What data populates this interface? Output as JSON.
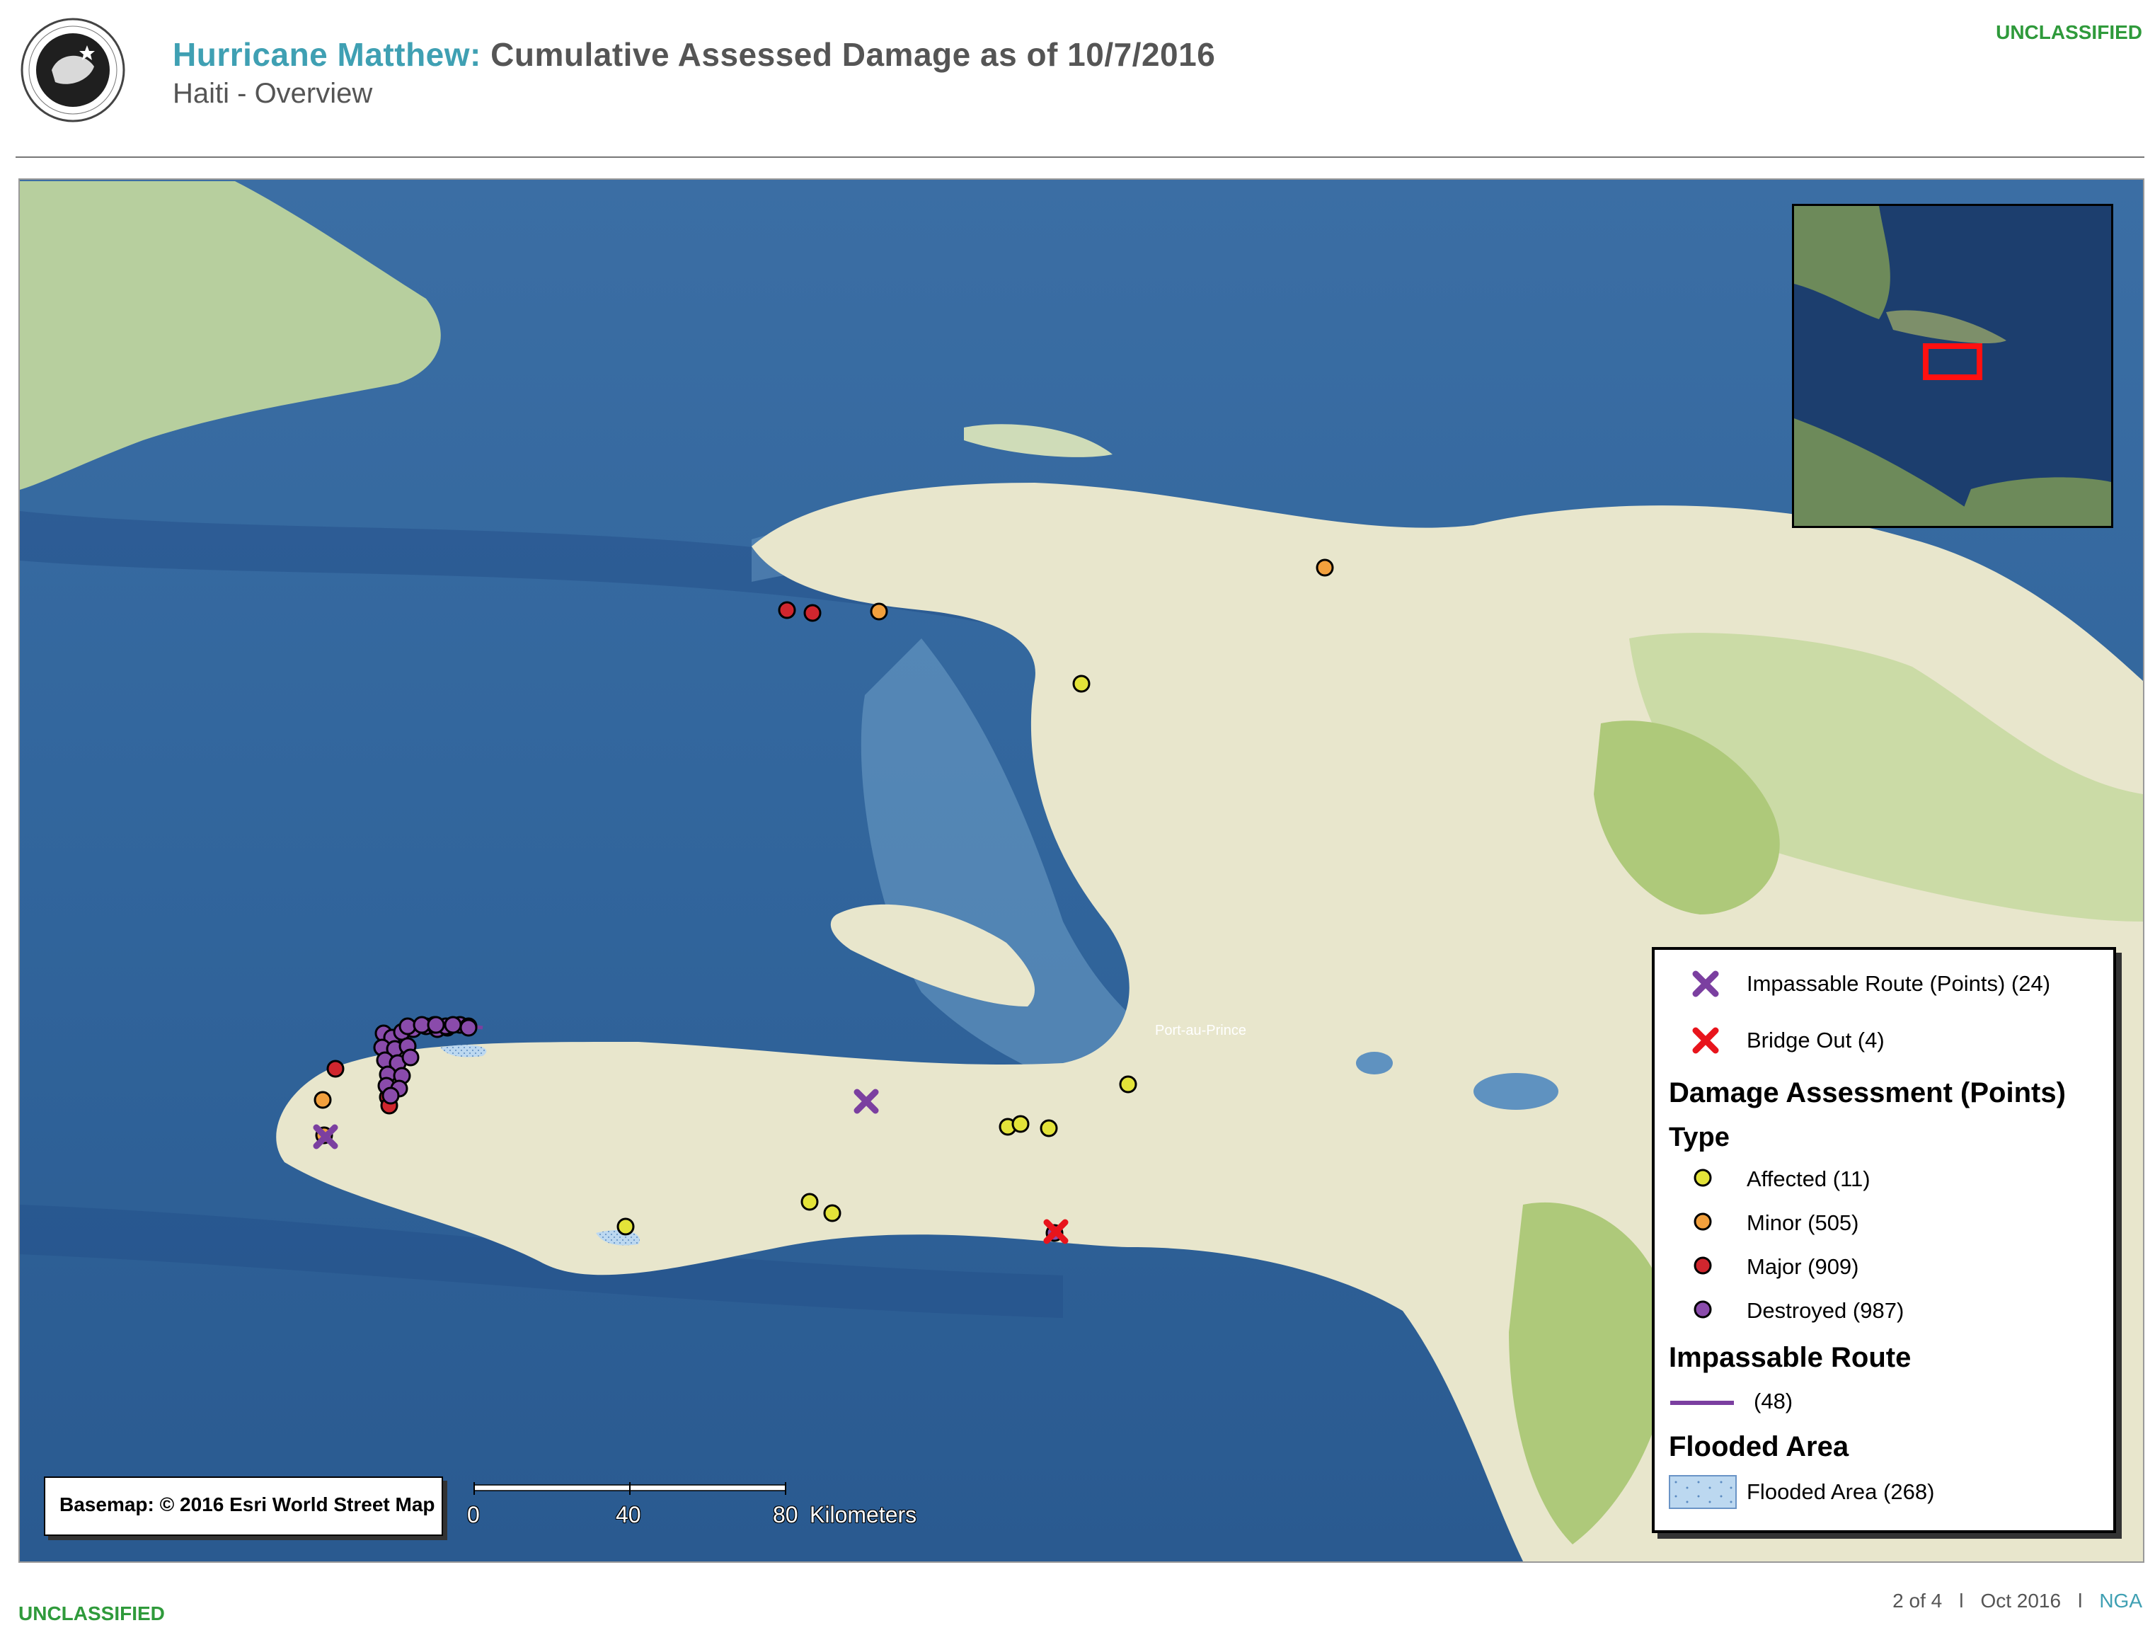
{
  "header": {
    "title_prefix": "Hurricane Matthew:",
    "title_rest": " Cumulative Assessed Damage as of 10/7/2016",
    "subtitle": "Haiti - Overview",
    "classification": "UNCLASSIFIED",
    "seal_text": "NATIONAL GEOSPATIAL-INTELLIGENCE AGENCY · UNITED STATES OF AMERICA"
  },
  "map": {
    "attribution": "Basemap: © 2016 Esri World Street Map",
    "city_label": "Port-au-Prince",
    "scalebar": {
      "ticks": [
        "0",
        "40",
        "80"
      ],
      "unit": "Kilometers"
    }
  },
  "legend": {
    "point_items": [
      {
        "label": "Impassable Route (Points) (24)",
        "symbol": "x-purple",
        "color": "#7b3fa0"
      },
      {
        "label": "Bridge Out (4)",
        "symbol": "x-red",
        "color": "#e8141c"
      }
    ],
    "damage_heading": "Damage Assessment (Points)",
    "type_heading": "Type",
    "damage_types": [
      {
        "label": "Affected (11)",
        "color": "#e3e339"
      },
      {
        "label": "Minor (505)",
        "color": "#f2a03d"
      },
      {
        "label": "Major (909)",
        "color": "#d0262e"
      },
      {
        "label": "Destroyed (987)",
        "color": "#8a4bab"
      }
    ],
    "route_heading": "Impassable Route",
    "route_item": {
      "label": "(48)",
      "color": "#7b3fa0"
    },
    "flood_heading": "Flooded Area",
    "flood_item": {
      "label": "Flooded Area (268)",
      "color": "#bcd8f0"
    }
  },
  "footer": {
    "classification": "UNCLASSIFIED",
    "page": "2 of 4",
    "separator": "l",
    "date": "Oct 2016",
    "agency": "NGA"
  },
  "markers": {
    "affected": [
      [
        1526,
        964
      ],
      [
        1422,
        1590
      ],
      [
        1440,
        1586
      ],
      [
        1480,
        1592
      ],
      [
        1592,
        1530
      ],
      [
        882,
        1731
      ],
      [
        1142,
        1696
      ],
      [
        1174,
        1712
      ]
    ],
    "minor": [
      [
        1240,
        862
      ],
      [
        1870,
        800
      ],
      [
        454,
        1552
      ],
      [
        456,
        1602
      ]
    ],
    "major": [
      [
        1110,
        860
      ],
      [
        1146,
        864
      ],
      [
        472,
        1508
      ],
      [
        546,
        1548
      ],
      [
        548,
        1560
      ]
    ],
    "destroyed": [
      [
        540,
        1458
      ],
      [
        552,
        1464
      ],
      [
        566,
        1456
      ],
      [
        582,
        1452
      ],
      [
        600,
        1448
      ],
      [
        616,
        1452
      ],
      [
        630,
        1450
      ],
      [
        648,
        1446
      ],
      [
        612,
        1446
      ],
      [
        628,
        1448
      ],
      [
        660,
        1448
      ],
      [
        574,
        1448
      ],
      [
        594,
        1446
      ],
      [
        538,
        1478
      ],
      [
        556,
        1480
      ],
      [
        574,
        1476
      ],
      [
        542,
        1496
      ],
      [
        560,
        1500
      ],
      [
        578,
        1492
      ],
      [
        546,
        1516
      ],
      [
        566,
        1518
      ],
      [
        544,
        1532
      ],
      [
        562,
        1536
      ],
      [
        550,
        1546
      ],
      [
        614,
        1446
      ],
      [
        638,
        1446
      ],
      [
        660,
        1450
      ],
      [
        1488,
        1740
      ]
    ],
    "impassable_points": [
      [
        1222,
        1554
      ],
      [
        458,
        1604
      ]
    ],
    "bridge_out": [
      [
        1490,
        1738
      ]
    ]
  }
}
